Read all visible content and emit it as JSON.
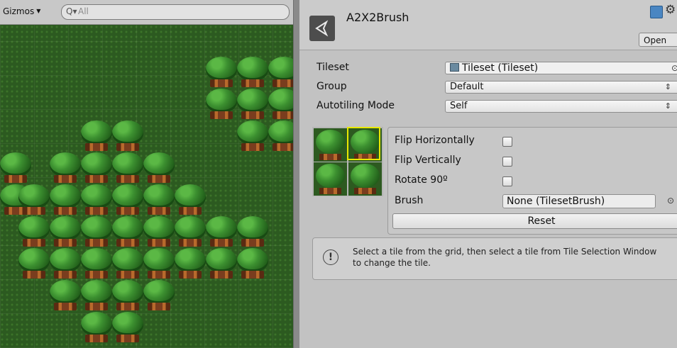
{
  "scene": {
    "gizmos_label": "Gizmos",
    "gizmos_caret": "▼",
    "search_icon": "Q▾",
    "search_text": "All"
  },
  "inspector": {
    "object_name": "A2X2Brush",
    "open_label": "Open",
    "settings_icon": "⚙",
    "properties": {
      "tileset_label": "Tileset",
      "tileset_value": "Tileset (Tileset)",
      "group_label": "Group",
      "group_value": "Default",
      "autotiling_label": "Autotiling Mode",
      "autotiling_value": "Self",
      "picker_glyph": "⊙",
      "popup_arrows": "⇕"
    },
    "tile_options": {
      "flip_h_label": "Flip Horizontally",
      "flip_v_label": "Flip Vertically",
      "rotate_label": "Rotate 90º",
      "brush_label": "Brush",
      "brush_value": "None (TilesetBrush)",
      "reset_label": "Reset"
    },
    "help": {
      "icon": "!",
      "text": "Select  a tile from the grid, then select a tile from Tile Selection Window to change the tile."
    }
  },
  "colors": {
    "panel_bg": "#c2c2c2",
    "grass": "#2c5a20",
    "highlight": "#e8e800"
  }
}
